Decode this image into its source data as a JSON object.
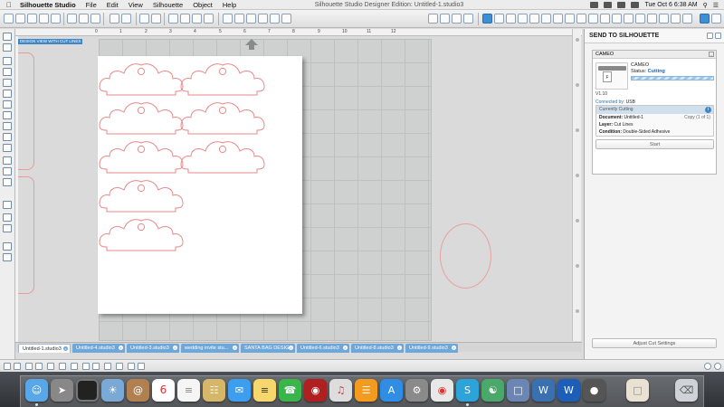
{
  "menubar": {
    "apple": "",
    "items": [
      "Silhouette Studio",
      "File",
      "Edit",
      "View",
      "Silhouette",
      "Object",
      "Help"
    ],
    "window_title": "Silhouette Studio Designer Edition: Untitled-1.studio3",
    "clock": "Tue Oct 6  6:38 AM"
  },
  "canvas": {
    "view_label": "DESIGN VIEW WITH CUT LINES",
    "ruler_ticks": [
      "0",
      "1",
      "2",
      "3",
      "4",
      "5",
      "6",
      "7",
      "8",
      "9",
      "10",
      "11",
      "12"
    ]
  },
  "colors": {
    "accent": "#3d86c7",
    "cut_line": "#e88a8a",
    "tab": "#6fa8d8"
  },
  "tabs": [
    "Untitled-1.studio3",
    "Untitled-4.studio3",
    "Untitled-3.studio3",
    "wedding invite stu...",
    "SANTA BAG DESIG...",
    "Untitled-6.studio3",
    "Untitled-8.studio3",
    "Untitled-9.studio3"
  ],
  "send_panel": {
    "title": "SEND TO SILHOUETTE",
    "device_header": "CAMEO",
    "machine_name": "CAMEO",
    "status_label": "Status:",
    "status_value": "Cutting",
    "version": "V1.10",
    "connected_label": "Connected by:",
    "connected_value": "USB",
    "job_header": "Currently Cutting",
    "document_label": "Document:",
    "document_value": "Untitled-1",
    "copy_text": "Copy (1 of 1)",
    "layer_label": "Layer:",
    "layer_value": "Cut Lines",
    "condition_label": "Condition:",
    "condition_value": "Double-Sided Adhesive",
    "start_button": "Start",
    "adjust_button": "Adjust Cut Settings",
    "progress": 0.5
  },
  "dock_apps": [
    "finder-icon",
    "launchpad-icon",
    "rocket-icon",
    "activity-icon",
    "preview-icon",
    "contacts-icon",
    "calendar-icon",
    "reminders-icon",
    "photos-icon",
    "messages-icon",
    "notes-icon",
    "facetime-icon",
    "photo-booth-icon",
    "itunes-icon",
    "ibooks-icon",
    "app-store-icon",
    "system-prefs-icon",
    "chrome-icon",
    "silhouette-icon",
    "photos-2-icon",
    "preview-2-icon",
    "word-icon",
    "dots-icon",
    "documents-icon",
    "trash-icon"
  ]
}
